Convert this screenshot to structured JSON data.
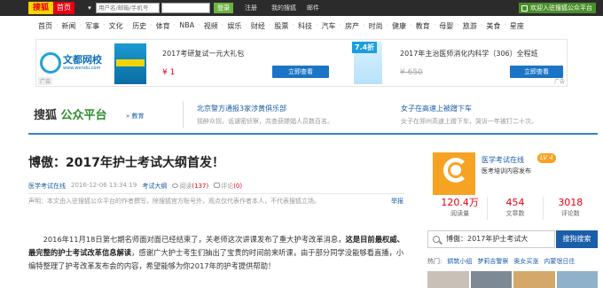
{
  "topbar": {
    "brand": "搜狐",
    "home": "首页",
    "login_placeholder": "用户名/邮箱/手机号",
    "login_button": "登录",
    "links": [
      "注册",
      "我的搜狐",
      "邮件"
    ],
    "welcome": "欢迎入驻搜狐公众平台"
  },
  "nav": {
    "items": [
      "首页",
      "新闻",
      "军事",
      "文化",
      "历史",
      "体育",
      "NBA",
      "视频",
      "娱乐",
      "财经",
      "股票",
      "科技",
      "汽车",
      "房产",
      "时尚",
      "健康",
      "教育",
      "母婴",
      "旅游",
      "美食",
      "星座"
    ]
  },
  "banner": {
    "logo_text": "文都网校",
    "logo_sub": "www.wendu.com",
    "ad_label": "广告",
    "ad1_title": "2017考研复试一元大礼包",
    "ad1_price": "¥ 1",
    "ad1_button": "立即查看",
    "ad2_badge": "7.4折",
    "ad2_title": "2017年主治医师消化内科学（306）全程班",
    "ad2_price": "¥ 650",
    "ad2_button": "立即查看"
  },
  "platform": {
    "logo_prefix": "搜狐",
    "logo_main": "公众平台",
    "home_link": "» 教育",
    "news": [
      {
        "title": "北京警方通报3家涉黄俱乐部",
        "sub": "摇醉众拐，诋谴密侦察，共查获嫖娼人员数百名。"
      },
      {
        "title": "女子在高速上被蹭下车",
        "sub": "女子在郑州高速上蹭下车，哭诉一年被打二十次。"
      }
    ]
  },
  "article": {
    "title": "博傲：2017年护士考试大纲首发！",
    "source": "医学考试在线",
    "datetime": "2016-12-06 13:34:19",
    "category": "考试大纲",
    "views_label": "阅读",
    "views": "(137)",
    "comments_label": "评论",
    "comments": "(0)",
    "disclaimer": "声明：本文由入驻搜狐公众平台的作者撰写，除搜狐官方账号外，观点仅代表作者本人，不代表搜狐立场。",
    "report": "举报",
    "para1_plain": "2016年11月18日第七期名师面对面已经结束了，关老师这次讲课发布了重大护考改革消息，",
    "para1_bold": "这是目前最权威、最完整的护士考试改革信息解读",
    "para1_rest": "，感谢广大护士考生们抽出了宝贵的时间前来听课，由于部分同学没能够看直播，小编特整理了护考改革发布会的内容，希望能够为你2017年的护考提供帮助！"
  },
  "author": {
    "name": "医学考试在线",
    "level": "LV 4",
    "desc": "医考培训内容发布",
    "stats": [
      {
        "num": "120.4万",
        "label": "阅读量"
      },
      {
        "num": "454",
        "label": "文章数"
      },
      {
        "num": "3018",
        "label": "评论数"
      }
    ]
  },
  "search": {
    "query": "博傲：2017年护士考试大",
    "button": "搜狗搜索",
    "hot_label": "热门:",
    "hot_words": [
      "鉷筑小组",
      "梦莉吉警察",
      "奥女买涨",
      "内蒙氓日往"
    ]
  },
  "colors": {
    "brand_red": "#e60012",
    "brand_yellow": "#ffd200",
    "link_blue": "#1a5da8",
    "accent_orange": "#f6a323"
  }
}
